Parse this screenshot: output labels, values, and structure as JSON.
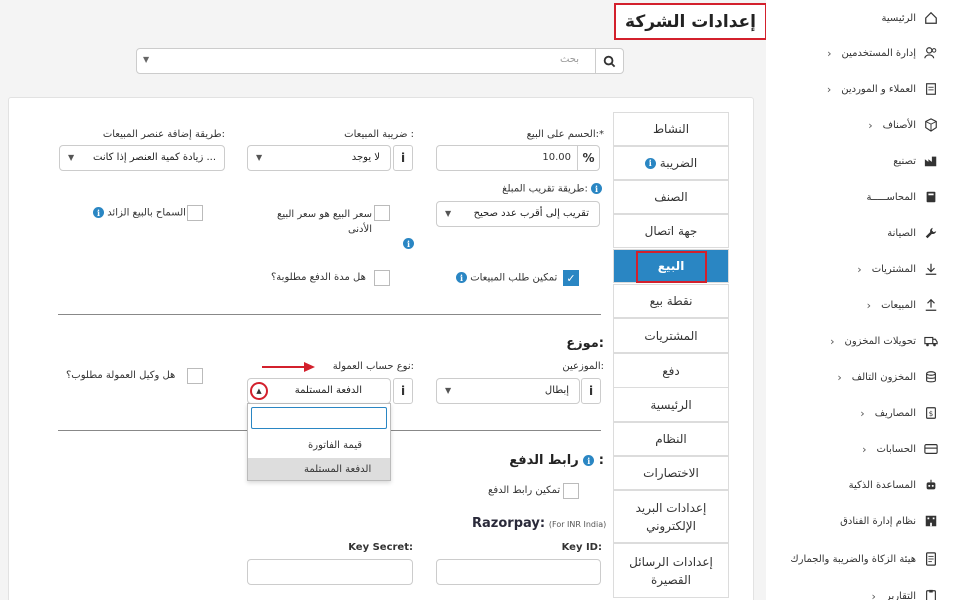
{
  "page": {
    "title": "إعدادات الشركة"
  },
  "search": {
    "placeholder": "بحث"
  },
  "sidebar": {
    "items": [
      {
        "label": "الرئيسية",
        "icon": "home-icon",
        "chev": false
      },
      {
        "label": "إدارة المستخدمين",
        "icon": "users-icon",
        "chev": true
      },
      {
        "label": "العملاء و الموردين",
        "icon": "contacts-icon",
        "chev": true
      },
      {
        "label": "الأصناف",
        "icon": "box-icon",
        "chev": true
      },
      {
        "label": "تصنيع",
        "icon": "factory-icon",
        "chev": false
      },
      {
        "label": "المحاســـــة",
        "icon": "book-icon",
        "chev": false
      },
      {
        "label": "الصيانة",
        "icon": "wrench-icon",
        "chev": false
      },
      {
        "label": "المشتريات",
        "icon": "download-icon",
        "chev": true
      },
      {
        "label": "المبيعات",
        "icon": "upload-icon",
        "chev": true
      },
      {
        "label": "تحويلات المخزون",
        "icon": "truck-icon",
        "chev": true
      },
      {
        "label": "المخزون التالف",
        "icon": "database-icon",
        "chev": true
      },
      {
        "label": "المصاريف",
        "icon": "money-icon",
        "chev": true
      },
      {
        "label": "الحسابات",
        "icon": "card-icon",
        "chev": true
      },
      {
        "label": "المساعدة الذكية",
        "icon": "robot-icon",
        "chev": false
      },
      {
        "label": "نظام إدارة الفنادق",
        "icon": "hotel-icon",
        "chev": false
      },
      {
        "label": "هيئة الزكاة والضريبة والجمارك",
        "icon": "document-icon",
        "chev": false
      },
      {
        "label": "التقارير",
        "icon": "report-icon",
        "chev": true
      }
    ]
  },
  "tabs": [
    {
      "label": "النشاط"
    },
    {
      "label": "الضريبة",
      "info": true
    },
    {
      "label": "الصنف"
    },
    {
      "label": "جهة اتصال"
    },
    {
      "label": "البيع",
      "active": true
    },
    {
      "label": "نقطة بيع"
    },
    {
      "label": "المشتريات"
    },
    {
      "label": "دفع"
    },
    {
      "label": "الرئيسية"
    },
    {
      "label": "النظام"
    },
    {
      "label": "الاختصارات"
    },
    {
      "label": "إعدادات البريد الإلكتروني"
    },
    {
      "label": "إعدادات الرسائل القصيرة"
    }
  ],
  "sale": {
    "discount_label": "الحسم على البيع:*",
    "discount_value": "10.00",
    "percent_symbol": "%",
    "tax_label": "ضريبة المبيعات :",
    "tax_value": "لا يوجد",
    "add_item_label": "طريقة إضافة عنصر المبيعات:",
    "add_item_value": "زيادة كمية العنصر إذا كانت ...",
    "rounding_label": "طريقة تقريب المبلغ:",
    "rounding_value": "تقريب إلى أقرب عدد صحيح",
    "min_price_label": "سعر البيع هو سعر البيع الأدنى",
    "allow_overselling_label": "السماح بالبيع الزائد",
    "enable_sales_order_label": "تمكين طلب المبيعات",
    "payment_term_label": "هل مدة الدفع مطلوبة؟"
  },
  "distributor": {
    "section_title": "موزع:",
    "distributors_label": "الموزعين:",
    "distributors_value": "إبطال",
    "commission_type_label": "نوع حساب العمولة:",
    "commission_type_value": "الدفعة المستلمة",
    "commission_agent_label": "هل وكيل العمولة مطلوب؟",
    "dropdown_options": [
      "قيمة الفاتورة",
      "الدفعة المستلمة"
    ]
  },
  "payment_link": {
    "section_title": "رابط الدفع",
    "enable_label": "تمكين رابط الدفع",
    "razorpay_title": "Razorpay:",
    "razorpay_note": "(For INR India)",
    "key_id_label": "Key ID:",
    "key_secret_label": "Key Secret:"
  },
  "colors": {
    "accent": "#2a86c3",
    "highlight": "#d3202c"
  }
}
